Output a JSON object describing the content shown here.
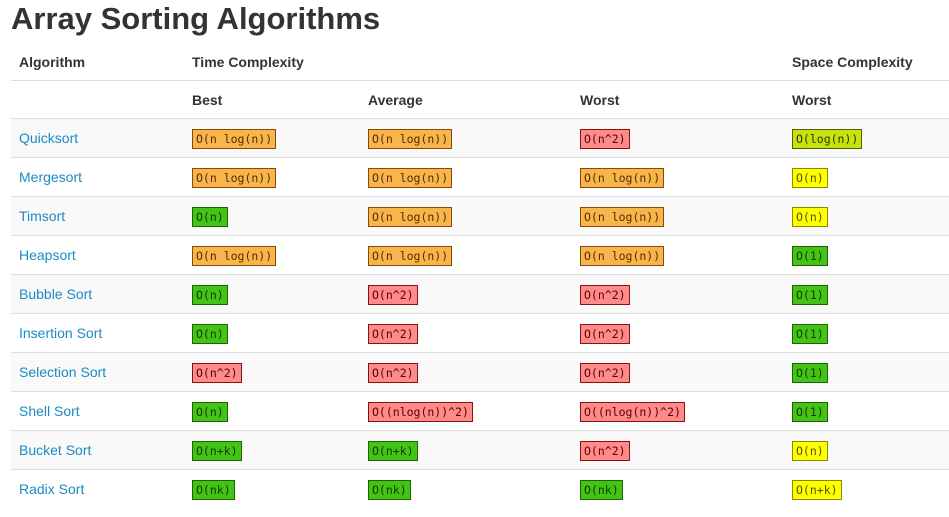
{
  "page": {
    "title": "Array Sorting Algorithms"
  },
  "table": {
    "headers": {
      "algorithm": "Algorithm",
      "time_complexity": "Time Complexity",
      "space_complexity": "Space Complexity",
      "best": "Best",
      "average": "Average",
      "worst": "Worst",
      "space_worst": "Worst"
    },
    "rows": [
      {
        "name": "Quicksort",
        "best": {
          "text": "O(n log(n))",
          "level": "orange"
        },
        "average": {
          "text": "O(n log(n))",
          "level": "orange"
        },
        "worst": {
          "text": "O(n^2)",
          "level": "red"
        },
        "space": {
          "text": "O(log(n))",
          "level": "lime"
        }
      },
      {
        "name": "Mergesort",
        "best": {
          "text": "O(n log(n))",
          "level": "orange"
        },
        "average": {
          "text": "O(n log(n))",
          "level": "orange"
        },
        "worst": {
          "text": "O(n log(n))",
          "level": "orange"
        },
        "space": {
          "text": "O(n)",
          "level": "yellow"
        }
      },
      {
        "name": "Timsort",
        "best": {
          "text": "O(n)",
          "level": "green"
        },
        "average": {
          "text": "O(n log(n))",
          "level": "orange"
        },
        "worst": {
          "text": "O(n log(n))",
          "level": "orange"
        },
        "space": {
          "text": "O(n)",
          "level": "yellow"
        }
      },
      {
        "name": "Heapsort",
        "best": {
          "text": "O(n log(n))",
          "level": "orange"
        },
        "average": {
          "text": "O(n log(n))",
          "level": "orange"
        },
        "worst": {
          "text": "O(n log(n))",
          "level": "orange"
        },
        "space": {
          "text": "O(1)",
          "level": "green"
        }
      },
      {
        "name": "Bubble Sort",
        "best": {
          "text": "O(n)",
          "level": "green"
        },
        "average": {
          "text": "O(n^2)",
          "level": "red"
        },
        "worst": {
          "text": "O(n^2)",
          "level": "red"
        },
        "space": {
          "text": "O(1)",
          "level": "green"
        }
      },
      {
        "name": "Insertion Sort",
        "best": {
          "text": "O(n)",
          "level": "green"
        },
        "average": {
          "text": "O(n^2)",
          "level": "red"
        },
        "worst": {
          "text": "O(n^2)",
          "level": "red"
        },
        "space": {
          "text": "O(1)",
          "level": "green"
        }
      },
      {
        "name": "Selection Sort",
        "best": {
          "text": "O(n^2)",
          "level": "red"
        },
        "average": {
          "text": "O(n^2)",
          "level": "red"
        },
        "worst": {
          "text": "O(n^2)",
          "level": "red"
        },
        "space": {
          "text": "O(1)",
          "level": "green"
        }
      },
      {
        "name": "Shell Sort",
        "best": {
          "text": "O(n)",
          "level": "green"
        },
        "average": {
          "text": "O((nlog(n))^2)",
          "level": "red"
        },
        "worst": {
          "text": "O((nlog(n))^2)",
          "level": "red"
        },
        "space": {
          "text": "O(1)",
          "level": "green"
        }
      },
      {
        "name": "Bucket Sort",
        "best": {
          "text": "O(n+k)",
          "level": "green"
        },
        "average": {
          "text": "O(n+k)",
          "level": "green"
        },
        "worst": {
          "text": "O(n^2)",
          "level": "red"
        },
        "space": {
          "text": "O(n)",
          "level": "yellow"
        }
      },
      {
        "name": "Radix Sort",
        "best": {
          "text": "O(nk)",
          "level": "green"
        },
        "average": {
          "text": "O(nk)",
          "level": "green"
        },
        "worst": {
          "text": "O(nk)",
          "level": "green"
        },
        "space": {
          "text": "O(n+k)",
          "level": "yellow"
        }
      }
    ]
  },
  "colors": {
    "link": "#1a8bc4",
    "orange": "#f7b54c",
    "red": "#ff8a8a",
    "green": "#43c316",
    "yellow": "#ffff00",
    "lime": "#c7e20d"
  }
}
